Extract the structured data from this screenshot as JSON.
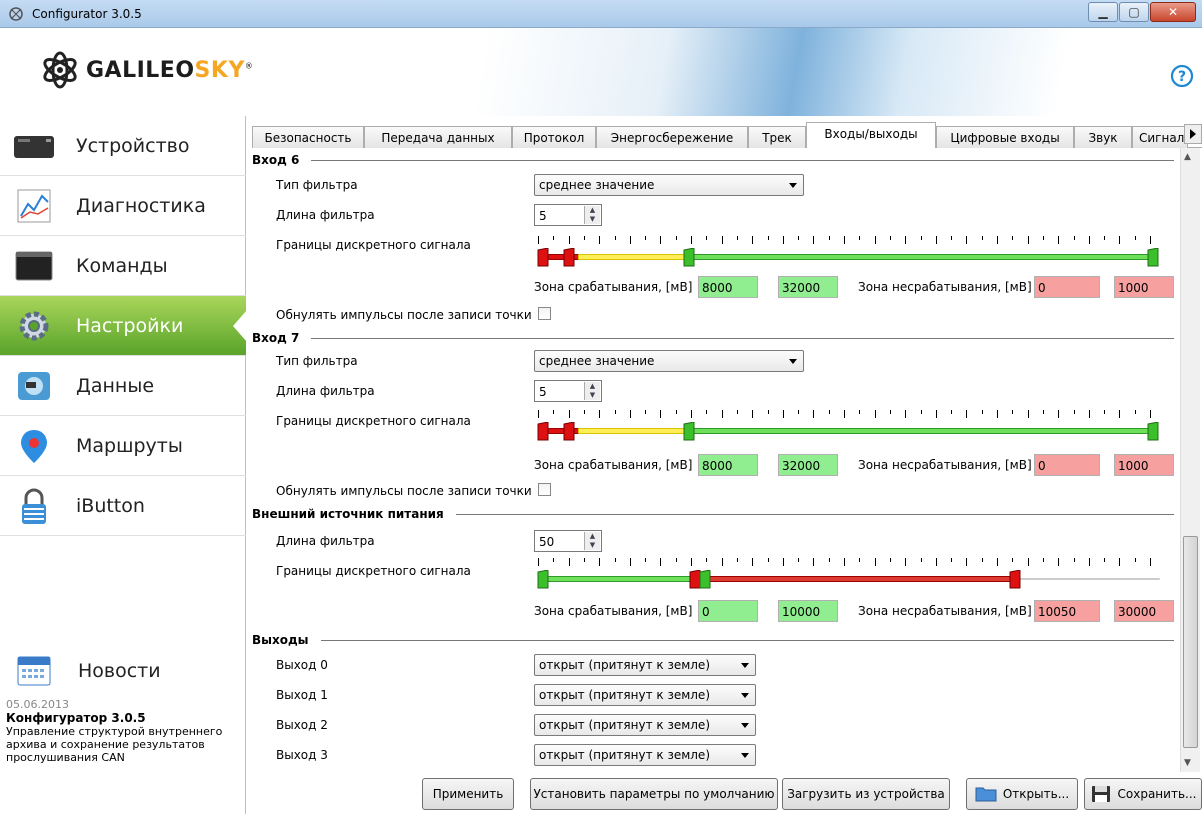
{
  "window": {
    "title": "Configurator 3.0.5"
  },
  "brand": {
    "name_dark": "GALILEO",
    "name_accent": "SKY",
    "mark": "®"
  },
  "sidebar": {
    "items": [
      {
        "label": "Устройство",
        "icon": "device-icon"
      },
      {
        "label": "Диагностика",
        "icon": "diagnostics-icon"
      },
      {
        "label": "Команды",
        "icon": "terminal-icon"
      },
      {
        "label": "Настройки",
        "icon": "gear-icon",
        "active": true
      },
      {
        "label": "Данные",
        "icon": "data-icon"
      },
      {
        "label": "Маршруты",
        "icon": "map-pin-icon"
      },
      {
        "label": "iButton",
        "icon": "lock-icon"
      }
    ],
    "news": {
      "label": "Новости",
      "date": "05.06.2013",
      "title": "Конфигуратор 3.0.5",
      "text": "Управление структурой внутреннего архива и сохранение результатов прослушивания CAN"
    }
  },
  "tabs": [
    {
      "label": "Безопасность"
    },
    {
      "label": "Передача данных"
    },
    {
      "label": "Протокол"
    },
    {
      "label": "Энергосбережение"
    },
    {
      "label": "Трек"
    },
    {
      "label": "Входы/выходы",
      "active": true
    },
    {
      "label": "Цифровые входы"
    },
    {
      "label": "Звук"
    },
    {
      "label": "Сигнал"
    }
  ],
  "labels": {
    "filter_type": "Тип фильтра",
    "filter_length": "Длина фильтра",
    "discrete_bounds": "Границы дискретного сигнала",
    "trigger_zone": "Зона срабатывания, [мВ]",
    "no_trigger_zone": "Зона несрабатывания, [мВ]",
    "reset_pulses": "Обнулять импульсы после записи точки"
  },
  "input6": {
    "title": "Вход 6",
    "filter_type": "среднее значение",
    "filter_length": "5",
    "trigger_from": "8000",
    "trigger_to": "32000",
    "no_trigger_from": "0",
    "no_trigger_to": "1000"
  },
  "input7": {
    "title": "Вход 7",
    "filter_type": "среднее значение",
    "filter_length": "5",
    "trigger_from": "8000",
    "trigger_to": "32000",
    "no_trigger_from": "0",
    "no_trigger_to": "1000"
  },
  "ext_power": {
    "title": "Внешний источник питания",
    "filter_length": "50",
    "trigger_from": "0",
    "trigger_to": "10000",
    "no_trigger_from": "10050",
    "no_trigger_to": "30000"
  },
  "outputs": {
    "title": "Выходы",
    "items": [
      {
        "label": "Выход 0",
        "value": "открыт (притянут к земле)"
      },
      {
        "label": "Выход 1",
        "value": "открыт (притянут к земле)"
      },
      {
        "label": "Выход 2",
        "value": "открыт (притянут к земле)"
      },
      {
        "label": "Выход 3",
        "value": "открыт (притянут к земле)"
      }
    ]
  },
  "buttons": {
    "apply": "Применить",
    "defaults": "Установить параметры по умолчанию",
    "load": "Загрузить из устройства",
    "open": "Открыть...",
    "save": "Сохранить..."
  },
  "colors": {
    "accent_green": "#5aa32b",
    "zone_green": "#90ee90",
    "zone_red": "#f7a0a0"
  }
}
